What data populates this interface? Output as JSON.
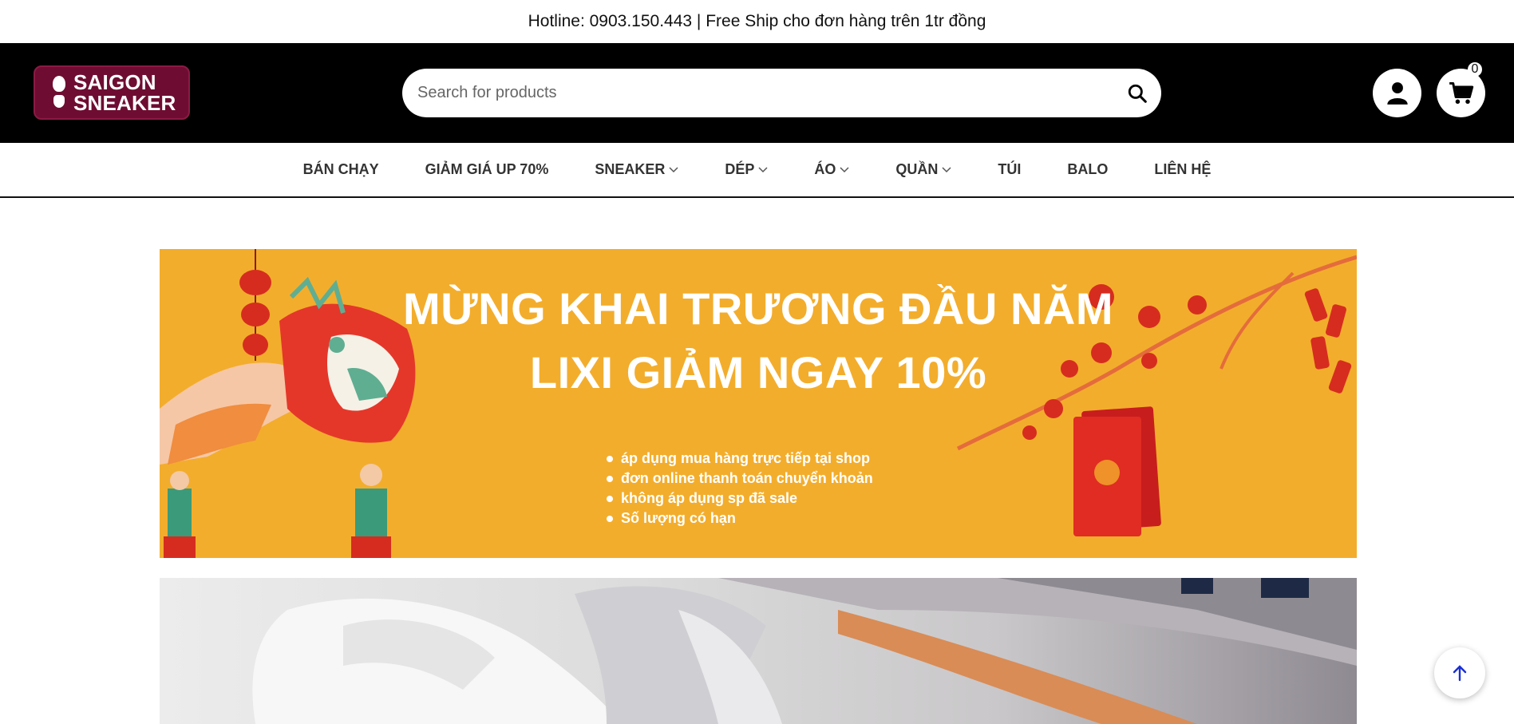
{
  "topbar": {
    "text": "Hotline: 0903.150.443 | Free Ship cho đơn hàng trên 1tr đồng"
  },
  "header": {
    "logo_line1": "SAIGON",
    "logo_line2": "SNEAKER",
    "search_placeholder": "Search for products",
    "cart_count": "0",
    "brand_color": "#6e0d31"
  },
  "nav": {
    "items": [
      {
        "label": "BÁN CHẠY",
        "dropdown": false
      },
      {
        "label": "GIẢM GIÁ UP 70%",
        "dropdown": false
      },
      {
        "label": "SNEAKER",
        "dropdown": true
      },
      {
        "label": "DÉP",
        "dropdown": true
      },
      {
        "label": "ÁO",
        "dropdown": true
      },
      {
        "label": "QUẦN",
        "dropdown": true
      },
      {
        "label": "TÚI",
        "dropdown": false
      },
      {
        "label": "BALO",
        "dropdown": false
      },
      {
        "label": "LIÊN HỆ",
        "dropdown": false
      }
    ]
  },
  "banner": {
    "title_line1": "MỪNG KHAI TRƯƠNG ĐẦU NĂM",
    "title_line2": "LIXI GIẢM NGAY 10%",
    "bullets": [
      "áp dụng mua hàng trực tiếp tại shop",
      "đơn online thanh toán chuyển khoản",
      "không áp dụng sp đã sale",
      "Số lượng có hạn"
    ],
    "bg_color": "#f3ad2c"
  },
  "icons": {
    "search": "search-icon",
    "user": "user-icon",
    "cart": "cart-icon",
    "chevron": "chevron-down-icon",
    "to_top": "arrow-up-icon"
  }
}
